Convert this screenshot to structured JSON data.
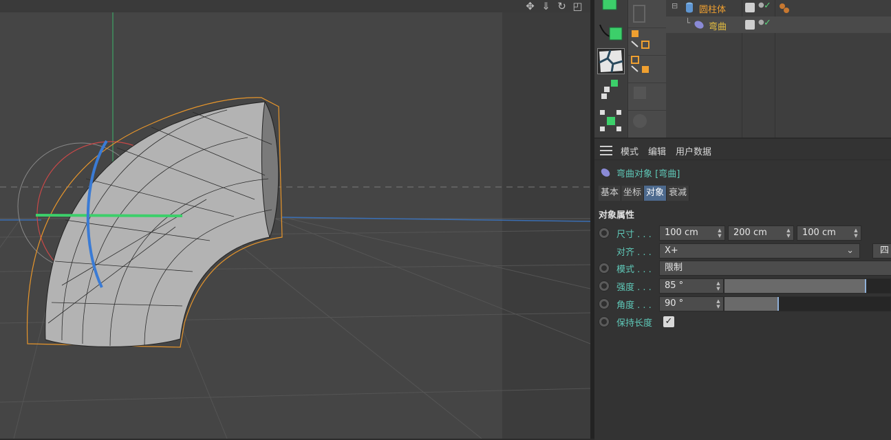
{
  "viewport": {
    "nav_icons": [
      "move-icon",
      "zoom-icon",
      "rotate-icon",
      "maximize-icon"
    ]
  },
  "object_manager": {
    "rows": [
      {
        "name": "圆柱体",
        "icon": "cylinder-icon",
        "color": "#f0a030",
        "visible_check": "✓"
      },
      {
        "name": "弯曲",
        "icon": "bend-deformer-icon",
        "color": "#e8c040",
        "visible_check": "✓"
      }
    ]
  },
  "attributes": {
    "menu": [
      "模式",
      "编辑",
      "用户数据"
    ],
    "object_title": "弯曲对象 [弯曲]",
    "tabs": [
      {
        "label": "基本",
        "active": false
      },
      {
        "label": "坐标",
        "active": false
      },
      {
        "label": "对象",
        "active": true
      },
      {
        "label": "衰减",
        "active": false
      }
    ],
    "section_title": "对象属性",
    "size": {
      "label": "尺寸 . . .",
      "x": "100 cm",
      "y": "200 cm",
      "z": "100 cm"
    },
    "align": {
      "label": "对齐 . . .",
      "value": "X+",
      "extra_button": "四"
    },
    "mode": {
      "label": "模式 . . .",
      "value": "限制"
    },
    "strength": {
      "label": "强度 . . .",
      "value": "85 °",
      "fraction": 0.85
    },
    "angle": {
      "label": "角度 . . .",
      "value": "90 °",
      "fraction": 0.325
    },
    "keep_length": {
      "label": "保持长度",
      "checked": true,
      "check": "✓"
    }
  },
  "colors": {
    "accent_teal": "#5fc8b8",
    "tab_active": "#4d6a8e",
    "orange": "#f0a030"
  }
}
